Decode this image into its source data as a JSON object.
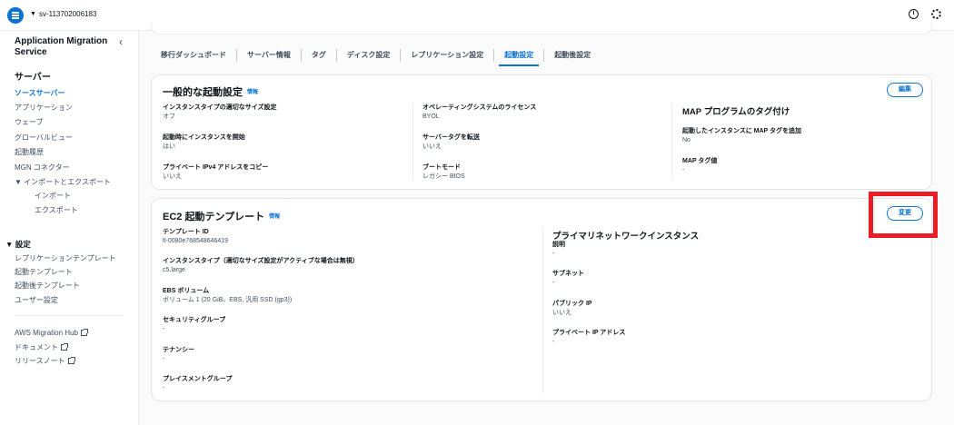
{
  "topbar": {
    "server_id": "sv-113702006183",
    "icons": [
      "menu-icon",
      "info-icon",
      "settings-icon"
    ]
  },
  "sidebar": {
    "title": "Application Migration Service",
    "server_section": "サーバー",
    "items": [
      {
        "label": "ソースサーバー",
        "active": true
      },
      {
        "label": "アプリケーション"
      },
      {
        "label": "ウェーブ"
      },
      {
        "label": "グローバルビュー"
      },
      {
        "label": "起動履歴"
      },
      {
        "label": "MGN コネクター"
      },
      {
        "label": "▼ インポートとエクスポート"
      },
      {
        "label": "インポート"
      },
      {
        "label": "エクスポート"
      }
    ],
    "settings_section": "▼ 設定",
    "settings_items": [
      "レプリケーションテンプレート",
      "起動テンプレート",
      "起動後テンプレート",
      "ユーザー設定"
    ],
    "links": [
      "AWS Migration Hub",
      "ドキュメント",
      "リリースノート"
    ]
  },
  "tabs": [
    {
      "label": "移行ダッシュボード"
    },
    {
      "label": "サーバー情報"
    },
    {
      "label": "タグ"
    },
    {
      "label": "ディスク設定"
    },
    {
      "label": "レプリケーション設定"
    },
    {
      "label": "起動設定",
      "active": true
    },
    {
      "label": "起動後設定"
    }
  ],
  "general": {
    "title": "一般的な起動設定",
    "info": "情報",
    "edit_button": "編集",
    "fields": [
      {
        "label": "インスタンスタイプの適切なサイズ設定",
        "value": "オフ"
      },
      {
        "label": "起動時にインスタンスを開始",
        "value": "はい"
      },
      {
        "label": "プライベート IPv4 アドレスをコピー",
        "value": "いいえ"
      },
      {
        "label": "オペレーティングシステムのライセンス",
        "value": "BYOL"
      },
      {
        "label": "サーバータグを転送",
        "value": "いいえ"
      },
      {
        "label": "ブートモード",
        "value": "レガシー BIOS"
      }
    ],
    "map": {
      "title": "MAP プログラムのタグ付け",
      "fields": [
        {
          "label": "起動したインスタンスに MAP タグを追加",
          "value": "No"
        },
        {
          "label": "MAP タグ値",
          "value": "-"
        }
      ]
    }
  },
  "ec2": {
    "title": "EC2 起動テンプレート",
    "info": "情報",
    "change_button": "変更",
    "fields": [
      {
        "label": "テンプレート ID",
        "value": "lt-0080e768548646419"
      },
      {
        "label": "インスタンスタイプ（適切なサイズ設定がアクティブな場合は無視）",
        "value": "c5.large"
      },
      {
        "label": "EBS ボリューム",
        "value": "ボリューム 1 (20 GiB、EBS, 汎用 SSD (gp3))"
      },
      {
        "label": "セキュリティグループ",
        "value": "-"
      },
      {
        "label": "テナンシー",
        "value": "-"
      },
      {
        "label": "プレイスメントグループ",
        "value": "-"
      }
    ],
    "primary_nic": {
      "title": "プライマリネットワークインスタンス",
      "fields": [
        {
          "label": "説明",
          "value": "-"
        },
        {
          "label": "サブネット",
          "value": "-"
        },
        {
          "label": "パブリック IP",
          "value": "いいえ"
        },
        {
          "label": "プライベート IP アドレス",
          "value": "-"
        }
      ]
    }
  },
  "colors": {
    "accent": "#0972d3",
    "highlight": "#ec1c24"
  }
}
